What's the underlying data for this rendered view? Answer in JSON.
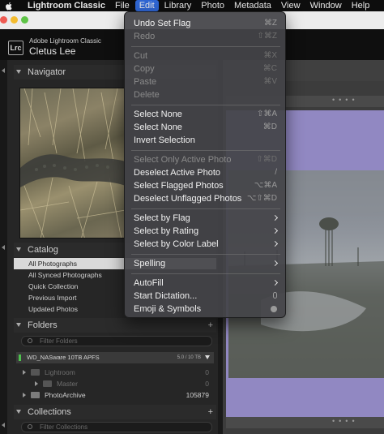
{
  "menubar": {
    "items": [
      "Lightroom Classic",
      "File",
      "Edit",
      "Library",
      "Photo",
      "Metadata",
      "View",
      "Window",
      "Help"
    ],
    "active": "Edit"
  },
  "identity": {
    "subtitle": "Adobe Lightroom Classic",
    "name": "Cletus Lee",
    "logo": "Lrc"
  },
  "panels": {
    "navigator": "Navigator",
    "catalog": "Catalog",
    "folders": "Folders",
    "collections": "Collections"
  },
  "catalog": {
    "items": [
      "All Photographs",
      "All Synced Photographs",
      "Quick Collection",
      "Previous Import",
      "Updated Photos"
    ],
    "selected": "All Photographs"
  },
  "folders": {
    "filter_placeholder": "Filter Folders",
    "volume": {
      "name": "WD_NASware 10TB APFS",
      "size": "5.0 / 10 TB"
    },
    "rows": [
      {
        "name": "Lightroom",
        "count": "0"
      },
      {
        "name": "Master",
        "count": "0"
      },
      {
        "name": "PhotoArchive",
        "count": "105879"
      }
    ]
  },
  "collections": {
    "filter_placeholder": "Filter Collections"
  },
  "edit_menu": {
    "undo": {
      "label": "Undo Set Flag",
      "shortcut": "⌘Z"
    },
    "redo": {
      "label": "Redo",
      "shortcut": "⇧⌘Z"
    },
    "cut": {
      "label": "Cut",
      "shortcut": "⌘X"
    },
    "copy": {
      "label": "Copy",
      "shortcut": "⌘C"
    },
    "paste": {
      "label": "Paste",
      "shortcut": "⌘V"
    },
    "delete": {
      "label": "Delete",
      "shortcut": ""
    },
    "select_all": {
      "label": "Select None",
      "shortcut": "⇧⌘A"
    },
    "select_none": {
      "label": "Select None",
      "shortcut": "⌘D"
    },
    "invert": {
      "label": "Invert Selection",
      "shortcut": ""
    },
    "select_only_active": {
      "label": "Select Only Active Photo",
      "shortcut": "⇧⌘D"
    },
    "deselect_active": {
      "label": "Deselect Active Photo",
      "shortcut": "/"
    },
    "select_flagged": {
      "label": "Select Flagged Photos",
      "shortcut": "⌥⌘A"
    },
    "deselect_unflagged": {
      "label": "Deselect Unflagged Photos",
      "shortcut": "⌥⇧⌘D"
    },
    "select_by_flag": "Select by Flag",
    "select_by_rating": "Select by Rating",
    "select_by_color": "Select by Color Label",
    "spelling": "Spelling",
    "autofill": "AutoFill",
    "dictation": "Start Dictation...",
    "emoji": "Emoji & Symbols"
  },
  "colors": {
    "menu_highlight": "#2f66d3",
    "folder_volume_indicator": "#4ec24e",
    "loupe_background": "#9188c2"
  }
}
